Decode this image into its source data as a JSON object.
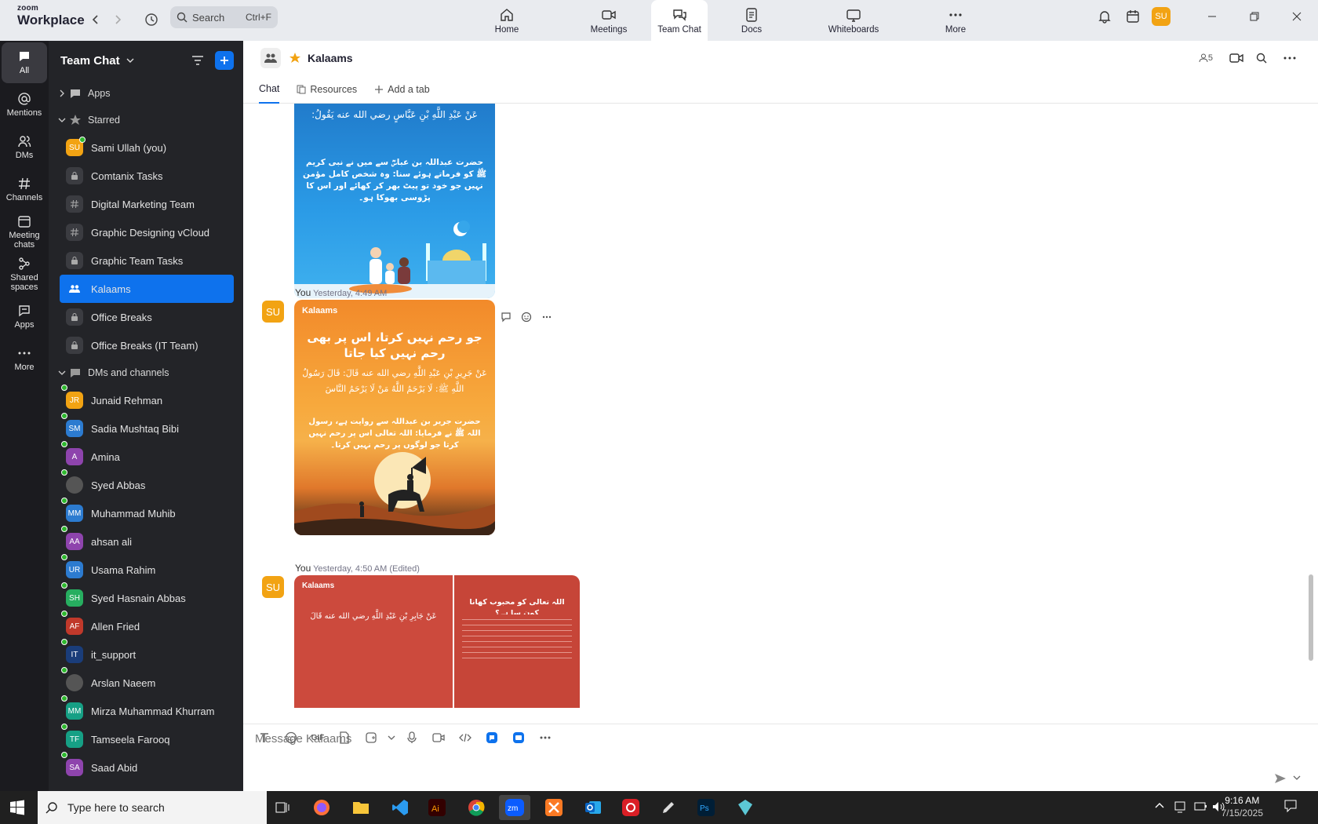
{
  "brand": {
    "top": "zoom",
    "bottom": "Workplace"
  },
  "search": {
    "label": "Search",
    "shortcut": "Ctrl+F"
  },
  "nav": {
    "tabs": [
      {
        "label": "Home",
        "icon": "home-icon"
      },
      {
        "label": "Meetings",
        "icon": "video-icon"
      },
      {
        "label": "Team Chat",
        "icon": "chat-icon"
      },
      {
        "label": "Docs",
        "icon": "docs-icon"
      },
      {
        "label": "Whiteboards",
        "icon": "whiteboard-icon"
      },
      {
        "label": "More",
        "icon": "more-icon"
      }
    ],
    "active": "Team Chat"
  },
  "user": {
    "initials": "SU",
    "status_color": "#2eb82e"
  },
  "rail": {
    "items": [
      {
        "label": "All",
        "icon": "chat-icon"
      },
      {
        "label": "Mentions",
        "icon": "at-icon"
      },
      {
        "label": "DMs",
        "icon": "people-icon"
      },
      {
        "label": "Channels",
        "icon": "hash-icon"
      },
      {
        "label": "Meeting chats",
        "icon": "calendar-icon"
      },
      {
        "label": "Shared spaces",
        "icon": "share-icon"
      },
      {
        "label": "Apps",
        "icon": "apps-icon"
      },
      {
        "label": "More",
        "icon": "more-icon"
      }
    ]
  },
  "sidebar": {
    "title": "Team Chat",
    "apps_label": "Apps",
    "starred_label": "Starred",
    "starred": [
      {
        "label": "Sami Ullah (you)",
        "type": "user",
        "initials": "SU",
        "color": "#f2a313"
      },
      {
        "label": "Comtanix Tasks",
        "type": "lock"
      },
      {
        "label": "Digital Marketing Team",
        "type": "hash"
      },
      {
        "label": "Graphic Designing vCloud",
        "type": "hash"
      },
      {
        "label": "Graphic Team Tasks",
        "type": "lock"
      },
      {
        "label": "Kalaams",
        "type": "group"
      },
      {
        "label": "Office Breaks",
        "type": "lock"
      },
      {
        "label": "Office Breaks (IT Team)",
        "type": "lock"
      }
    ],
    "dms_label": "DMs and channels",
    "dms": [
      {
        "label": "Junaid Rehman",
        "initials": "JR",
        "color": "#f2a313"
      },
      {
        "label": "Sadia Mushtaq Bibi",
        "initials": "SM",
        "color": "#2c7bd0"
      },
      {
        "label": "Amina",
        "initials": "A",
        "color": "#8e44ad"
      },
      {
        "label": "Syed Abbas",
        "initials": "",
        "color": "#555"
      },
      {
        "label": "Muhammad Muhib",
        "initials": "MM",
        "color": "#2c7bd0"
      },
      {
        "label": "ahsan ali",
        "initials": "AA",
        "color": "#8e44ad"
      },
      {
        "label": "Usama Rahim",
        "initials": "UR",
        "color": "#2c7bd0"
      },
      {
        "label": "Syed Hasnain Abbas",
        "initials": "SH",
        "color": "#27ae60"
      },
      {
        "label": "Allen Fried",
        "initials": "AF",
        "color": "#c0392b"
      },
      {
        "label": "it_support",
        "initials": "IT",
        "color": "#1a3d7a"
      },
      {
        "label": "Arslan Naeem",
        "initials": "",
        "color": "#555"
      },
      {
        "label": "Mirza Muhammad Khurram",
        "initials": "MM",
        "color": "#16a085"
      },
      {
        "label": "Tamseela Farooq",
        "initials": "TF",
        "color": "#16a085"
      },
      {
        "label": "Saad Abid",
        "initials": "SA",
        "color": "#8e44ad"
      }
    ]
  },
  "chat": {
    "title": "Kalaams",
    "members": "5",
    "tabs": [
      {
        "label": "Chat"
      },
      {
        "label": "Resources"
      },
      {
        "label": "Add a tab"
      }
    ],
    "messages": [
      {
        "sender": "You",
        "time": "Yesterday, 4:49 AM",
        "avatar": "SU"
      },
      {
        "sender": "You",
        "time": "Yesterday, 4:50 AM (Edited)",
        "avatar": "SU"
      }
    ],
    "card1": {
      "ar": "عَنْ عَبْدِ اللَّهِ بْنِ عَبَّاسٍ رضي الله عنه يَقُولُ:",
      "ur": "حضرت عبداللہ بن عباسؓ سے میں نے نبی کریم ﷺ کو فرماتے ہوئے سنا: وہ شخص کامل مؤمن نہیں جو خود تو پیٹ بھر کر کھائے اور اس کا پڑوسی بھوکا ہو۔"
    },
    "card2": {
      "brand": "Kalaams",
      "title": "جو رحم نہیں کرتا، اس پر بھی رحم نہیں کیا جاتا",
      "ar": "عَنْ جَرِيرِ بْنِ عَبْدِ اللَّهِ رضي الله عنه قَالَ: قَالَ رَسُولُ اللَّهِ ﷺ: لَا يَرْحَمُ اللَّهُ مَنْ لَا يَرْحَمُ النَّاسَ",
      "ur": "حضرت جریر بن عبداللہ سے روایت ہے، رسول اللہ ﷺ نے فرمایا: اللہ تعالی اس پر رحم نہیں کرتا جو لوگوں پر رحم نہیں کرتا۔"
    },
    "card3": {
      "brand": "Kalaams",
      "ar": "عَنْ جَابِرِ بْنِ عَبْدِ اللَّهِ رضي الله عنه قَالَ",
      "title2": "اللہ تعالی کو محبوب کھانا کون سا ہے؟"
    },
    "composer_placeholder": "Message Kalaams"
  },
  "taskbar": {
    "search": "Type here to search",
    "time": "9:16 AM",
    "date": "7/15/2025"
  }
}
